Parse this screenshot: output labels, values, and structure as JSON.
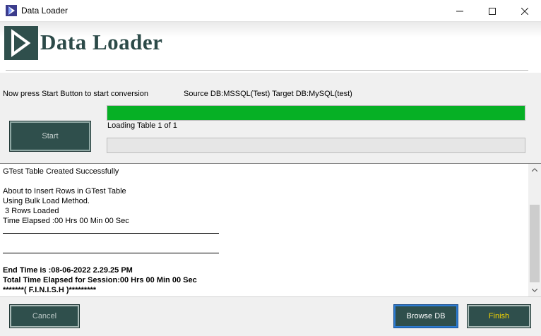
{
  "window": {
    "title": "Data Loader",
    "controls": {
      "minimize": "—",
      "maximize": "☐",
      "close": "✕"
    }
  },
  "header": {
    "logo_icon": "play-arrow-logo",
    "title": "Data Loader"
  },
  "status": {
    "message": "Now press Start Button to start conversion",
    "source_target": "Source DB:MSSQL(Test) Target DB:MySQL(test)",
    "loading_text": "Loading Table 1 of 1"
  },
  "progress": {
    "overall_fraction": 1.0,
    "table_fraction": 0.0
  },
  "buttons": {
    "start": "Start",
    "cancel": "Cancel",
    "browse_db": "Browse DB",
    "finish": "Finish"
  },
  "log": {
    "lines": [
      {
        "text": "GTest Table Created Successfully",
        "bold": false
      },
      {
        "text": "",
        "bold": false
      },
      {
        "text": "About to Insert Rows in GTest Table",
        "bold": false
      },
      {
        "text": "Using Bulk Load Method.",
        "bold": false
      },
      {
        "text": " 3 Rows Loaded",
        "bold": false
      },
      {
        "text": "Time Elapsed :00 Hrs 00 Min 00 Sec",
        "bold": false
      },
      {
        "rule": true
      },
      {
        "text": "",
        "bold": false
      },
      {
        "rule": true
      },
      {
        "text": "",
        "bold": false
      },
      {
        "text": "End Time is :08-06-2022 2.29.25 PM",
        "bold": true
      },
      {
        "text": "Total Time Elapsed for Session:00 Hrs 00 Min 00 Sec",
        "bold": true
      },
      {
        "text": "*******( F.I.N.I.S.H )*********",
        "bold": true
      }
    ]
  },
  "colors": {
    "accent_dark": "#2f4f4c",
    "progress_green": "#06b025",
    "finish_text": "#f5d400"
  }
}
